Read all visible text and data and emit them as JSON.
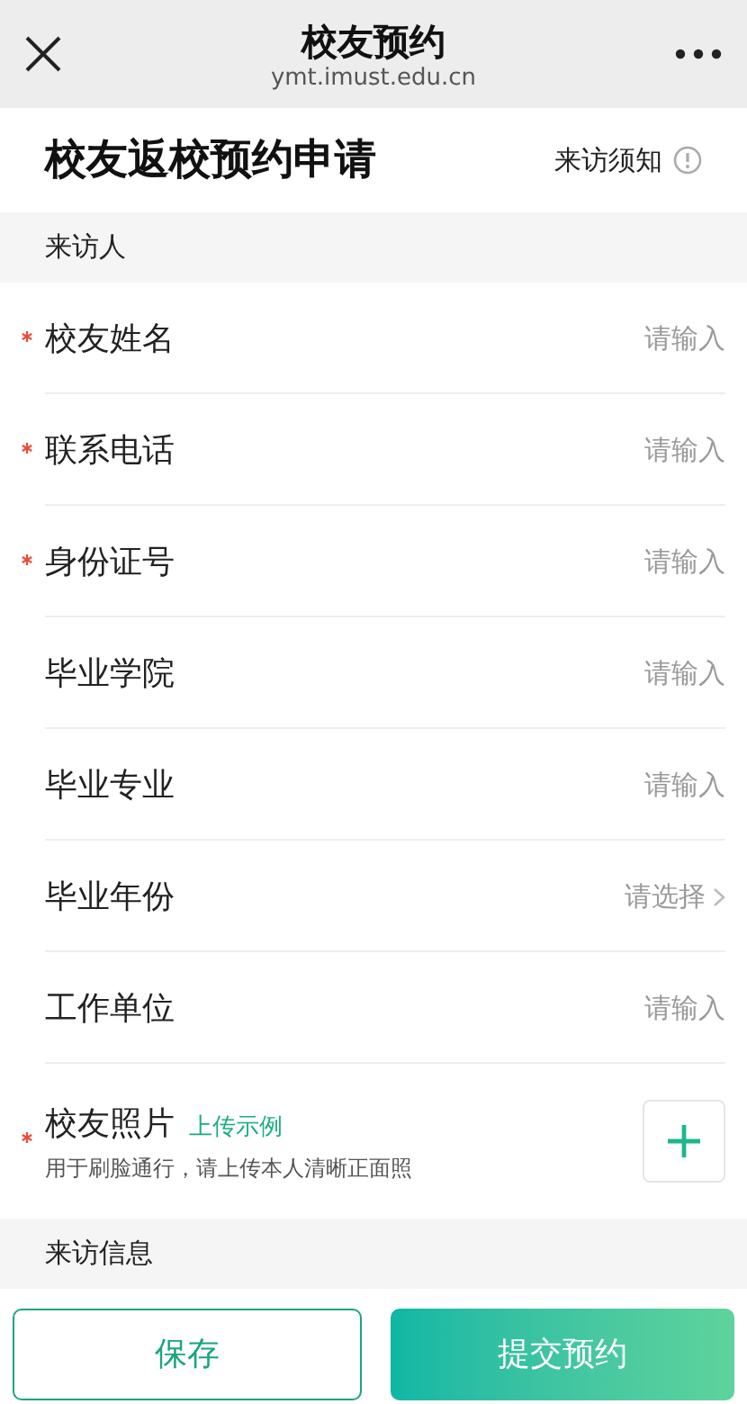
{
  "nav": {
    "title": "校友预约",
    "subtitle": "ymt.imust.edu.cn"
  },
  "header": {
    "title": "校友返校预约申请",
    "notice_link": "来访须知"
  },
  "sections": [
    {
      "title": "来访人"
    }
  ],
  "fields": [
    {
      "label": "校友姓名",
      "required": true,
      "kind": "input",
      "placeholder": "请输入"
    },
    {
      "label": "联系电话",
      "required": true,
      "kind": "input",
      "placeholder": "请输入"
    },
    {
      "label": "身份证号",
      "required": true,
      "kind": "input",
      "placeholder": "请输入"
    },
    {
      "label": "毕业学院",
      "required": false,
      "kind": "input",
      "placeholder": "请输入"
    },
    {
      "label": "毕业专业",
      "required": false,
      "kind": "input",
      "placeholder": "请输入"
    },
    {
      "label": "毕业年份",
      "required": false,
      "kind": "select",
      "placeholder": "请选择"
    },
    {
      "label": "工作单位",
      "required": false,
      "kind": "input",
      "placeholder": "请输入"
    }
  ],
  "photo": {
    "label": "校友照片",
    "required": true,
    "example_link": "上传示例",
    "hint": "用于刷脸通行，请上传本人清晰正面照"
  },
  "next_section": {
    "title": "来访信息"
  },
  "buttons": {
    "save": "保存",
    "submit": "提交预约"
  }
}
